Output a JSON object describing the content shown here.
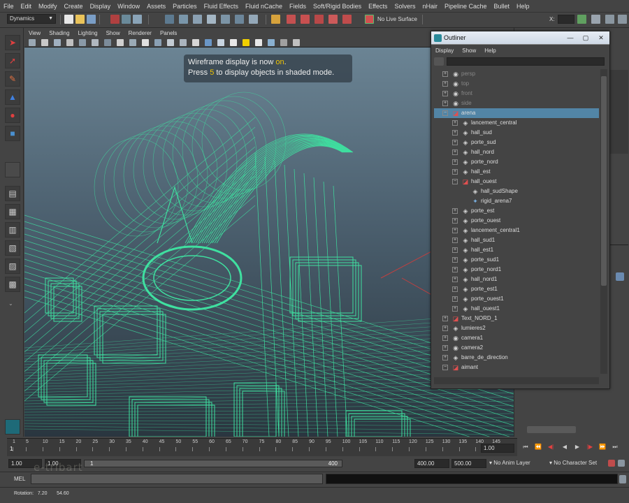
{
  "menubar": {
    "items": [
      "File",
      "Edit",
      "Modify",
      "Create",
      "Display",
      "Window",
      "Assets",
      "Particles",
      "Fluid Effects",
      "Fluid nCache",
      "Fields",
      "Soft/Rigid Bodies",
      "Effects",
      "Solvers",
      "nHair",
      "Pipeline Cache",
      "Bullet",
      "Help"
    ]
  },
  "statusline": {
    "menuset": "Dynamics",
    "live_surface": "No Live Surface",
    "x_label": "X:"
  },
  "viewport": {
    "menus": [
      "View",
      "Shading",
      "Lighting",
      "Show",
      "Renderer",
      "Panels"
    ],
    "hud": {
      "line1_prefix": "Wireframe display is now ",
      "line1_on": "on",
      "line1_suffix": ".",
      "line2_prefix": "Press ",
      "line2_key": "5",
      "line2_suffix": " to display objects in shaded mode."
    },
    "wire_color": "#3fe0a0"
  },
  "outliner": {
    "title": "Outliner",
    "menus": [
      "Display",
      "Show",
      "Help"
    ],
    "filter_value": "",
    "rows": [
      {
        "label": "persp",
        "depth": 0,
        "exp": "+",
        "icon": "camera-icon",
        "dim": true
      },
      {
        "label": "top",
        "depth": 0,
        "exp": "+",
        "icon": "camera-icon",
        "dim": true
      },
      {
        "label": "front",
        "depth": 0,
        "exp": "+",
        "icon": "camera-icon",
        "dim": true
      },
      {
        "label": "side",
        "depth": 0,
        "exp": "+",
        "icon": "camera-icon",
        "dim": true
      },
      {
        "label": "arena",
        "depth": 0,
        "exp": "−",
        "icon": "group-icon",
        "sel": true
      },
      {
        "label": "lancement_central",
        "depth": 1,
        "exp": "+",
        "icon": "mesh-icon"
      },
      {
        "label": "hall_sud",
        "depth": 1,
        "exp": "+",
        "icon": "mesh-icon"
      },
      {
        "label": "porte_sud",
        "depth": 1,
        "exp": "+",
        "icon": "mesh-icon"
      },
      {
        "label": "hall_nord",
        "depth": 1,
        "exp": "+",
        "icon": "mesh-icon"
      },
      {
        "label": "porte_nord",
        "depth": 1,
        "exp": "+",
        "icon": "mesh-icon"
      },
      {
        "label": "hall_est",
        "depth": 1,
        "exp": "+",
        "icon": "mesh-icon"
      },
      {
        "label": "hall_ouest",
        "depth": 1,
        "exp": "−",
        "icon": "group-icon"
      },
      {
        "label": "hall_sudShape",
        "depth": 2,
        "exp": "",
        "icon": "mesh-icon"
      },
      {
        "label": "rigid_arena7",
        "depth": 2,
        "exp": "",
        "icon": "rigid-body-icon"
      },
      {
        "label": "porte_est",
        "depth": 1,
        "exp": "+",
        "icon": "mesh-icon"
      },
      {
        "label": "porte_ouest",
        "depth": 1,
        "exp": "+",
        "icon": "mesh-icon"
      },
      {
        "label": "lancement_central1",
        "depth": 1,
        "exp": "+",
        "icon": "mesh-icon"
      },
      {
        "label": "hall_sud1",
        "depth": 1,
        "exp": "+",
        "icon": "mesh-icon"
      },
      {
        "label": "hall_est1",
        "depth": 1,
        "exp": "+",
        "icon": "mesh-icon"
      },
      {
        "label": "porte_sud1",
        "depth": 1,
        "exp": "+",
        "icon": "mesh-icon"
      },
      {
        "label": "porte_nord1",
        "depth": 1,
        "exp": "+",
        "icon": "mesh-icon"
      },
      {
        "label": "hall_nord1",
        "depth": 1,
        "exp": "+",
        "icon": "mesh-icon"
      },
      {
        "label": "porte_est1",
        "depth": 1,
        "exp": "+",
        "icon": "mesh-icon"
      },
      {
        "label": "porte_ouest1",
        "depth": 1,
        "exp": "+",
        "icon": "mesh-icon"
      },
      {
        "label": "hall_ouest1",
        "depth": 1,
        "exp": "+",
        "icon": "mesh-icon"
      },
      {
        "label": "Text_NORD_1",
        "depth": 0,
        "exp": "+",
        "icon": "group-icon"
      },
      {
        "label": "lumieres2",
        "depth": 0,
        "exp": "+",
        "icon": "mesh-icon"
      },
      {
        "label": "camera1",
        "depth": 0,
        "exp": "+",
        "icon": "camera-icon"
      },
      {
        "label": "camera2",
        "depth": 0,
        "exp": "+",
        "icon": "camera-icon"
      },
      {
        "label": "barre_de_direction",
        "depth": 0,
        "exp": "+",
        "icon": "mesh-icon"
      },
      {
        "label": "aimant",
        "depth": 0,
        "exp": "−",
        "icon": "group-icon"
      }
    ]
  },
  "timeslider": {
    "ticks": [
      "1",
      "5",
      "10",
      "15",
      "20",
      "25",
      "30",
      "35",
      "40",
      "45",
      "50",
      "55",
      "60",
      "65",
      "70",
      "75",
      "80",
      "85",
      "90",
      "95",
      "100",
      "105",
      "110",
      "115",
      "120",
      "125",
      "130",
      "135",
      "140",
      "145"
    ],
    "current_frame": "1",
    "current_time_field": "1.00"
  },
  "range": {
    "start_time": "1.00",
    "playback_start": "1.00",
    "range_start_label": "1",
    "range_end_label": "400",
    "playback_end": "400.00",
    "end_time": "500.00",
    "anim_layer": "No Anim Layer",
    "character_set": "No Character Set"
  },
  "cmdline": {
    "label": "MEL"
  },
  "helpline": {
    "text": "Rotation:   7.20       54.60"
  },
  "watermark": "e-tribart"
}
